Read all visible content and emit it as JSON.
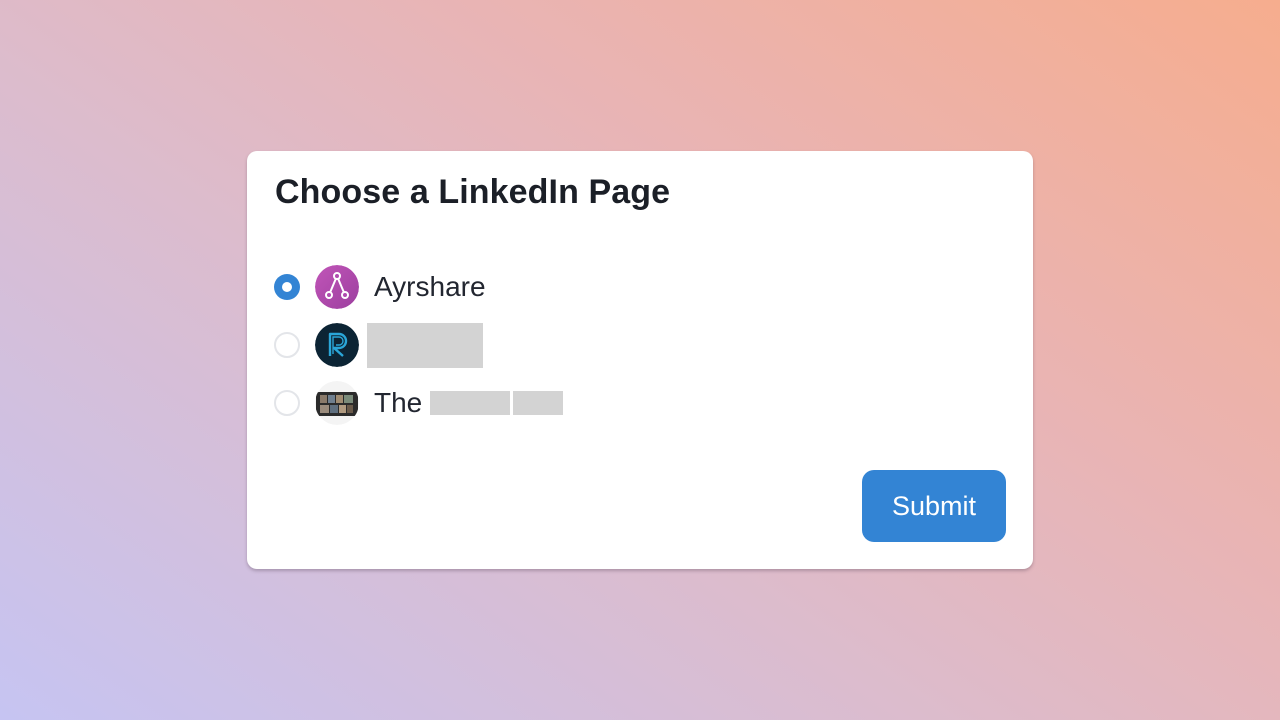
{
  "dialog": {
    "title": "Choose a LinkedIn Page",
    "submit_label": "Submit"
  },
  "options": [
    {
      "label": "Ayrshare",
      "selected": true,
      "avatar": "ayrshare-logo"
    },
    {
      "label": "",
      "selected": false,
      "avatar": "r-logo",
      "redacted": true
    },
    {
      "label": "The",
      "selected": false,
      "avatar": "photo-thumbnail",
      "redacted": true
    }
  ],
  "colors": {
    "accent": "#3384d4",
    "ayrshare_avatar": "#b04cb0",
    "r_avatar": "#0c2434",
    "redaction": "#d3d3d3"
  }
}
